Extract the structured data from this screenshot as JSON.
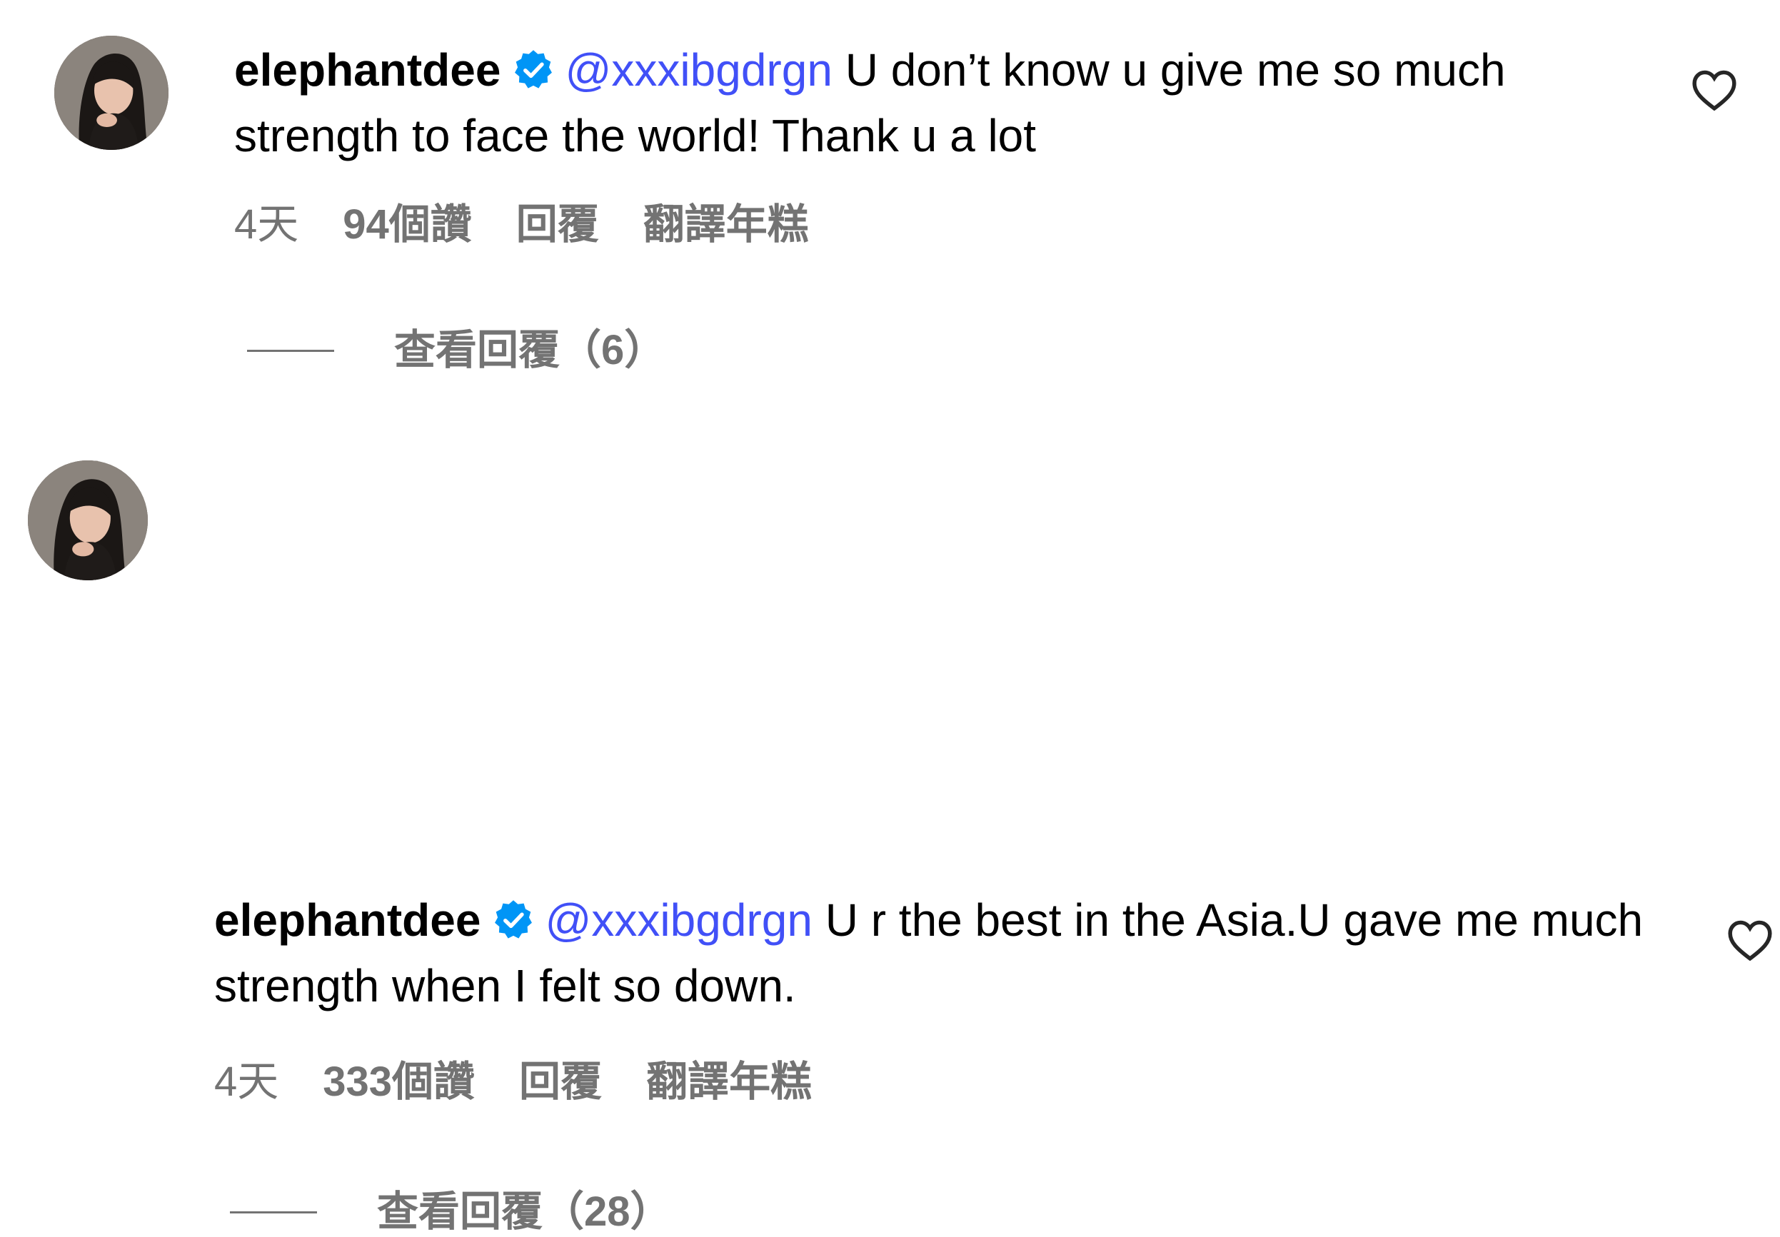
{
  "comments": [
    {
      "username": "elephantdee",
      "mention": "@xxxibgdrgn",
      "text": " U don’t know u give me so much strength to face the world! Thank u a lot",
      "time": "4天",
      "likes": "94個讚",
      "reply_label": "回覆",
      "translate_label": "翻譯年糕",
      "view_replies": "查看回覆（6）",
      "avatar_icon": "avatar-photo",
      "verified_icon": "verified-badge-icon",
      "like_icon": "heart-icon"
    },
    {
      "username": "elephantdee",
      "mention": "@xxxibgdrgn",
      "text": " U r the best in the Asia.U gave me much strength when I felt so down.",
      "time": "4天",
      "likes": "333個讚",
      "reply_label": "回覆",
      "translate_label": "翻譯年糕",
      "view_replies": "查看回覆（28）",
      "avatar_icon": "avatar-photo",
      "verified_icon": "verified-badge-icon",
      "like_icon": "heart-icon"
    }
  ],
  "colors": {
    "mention": "#4150f7",
    "verified": "#0095f6",
    "meta_text": "#737373",
    "primary_text": "#000000"
  }
}
